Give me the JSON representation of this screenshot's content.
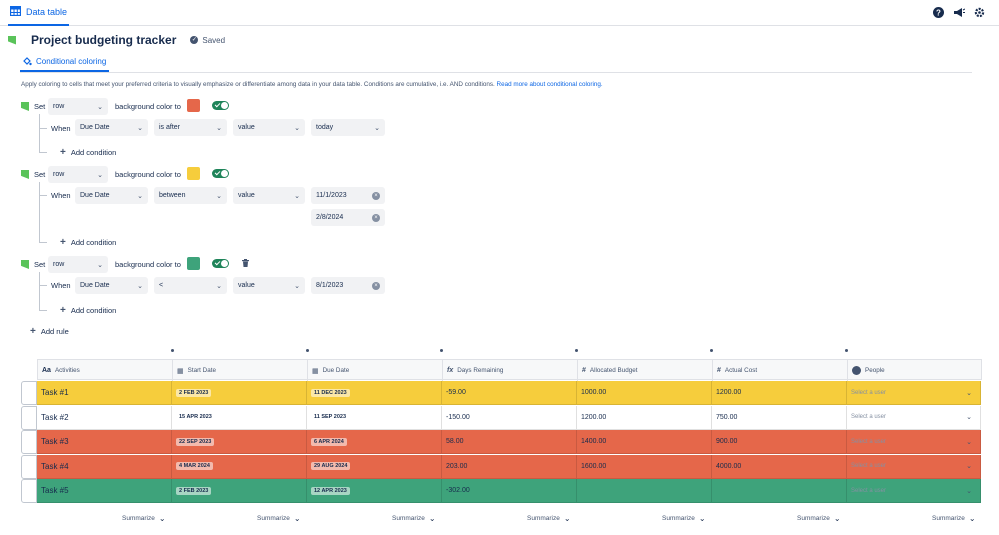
{
  "topbar": {
    "tab_label": "Data table",
    "icons": [
      "help-icon",
      "megaphone-icon",
      "settings-icon"
    ]
  },
  "title": "Project budgeting tracker",
  "saved": "Saved",
  "cc_tab": "Conditional coloring",
  "description": "Apply coloring to cells that meet your preferred criteria to visually emphasize or differentiate among data in your data table. Conditions are cumulative, i.e. AND conditions.",
  "description_link": "Read more about conditional coloring.",
  "labels": {
    "set": "Set",
    "when": "When",
    "bg": "background color to",
    "add_condition": "Add condition",
    "add_rule": "Add rule"
  },
  "rules": [
    {
      "target": "row",
      "color": "#e5674a",
      "enabled": true,
      "conditions": [
        {
          "field": "Due Date",
          "op": "is after",
          "type": "value",
          "value": "today"
        }
      ]
    },
    {
      "target": "row",
      "color": "#f6cd3c",
      "enabled": true,
      "conditions": [
        {
          "field": "Due Date",
          "op": "between",
          "type": "value",
          "value": "11/1/2023",
          "value2": "2/8/2024"
        }
      ]
    },
    {
      "target": "row",
      "color": "#3ea37b",
      "enabled": true,
      "conditions": [
        {
          "field": "Due Date",
          "op": "<",
          "type": "value",
          "value": "8/1/2023"
        }
      ]
    }
  ],
  "columns": [
    "Activities",
    "Start Date",
    "Due Date",
    "Days Remaining",
    "Allocated Budget",
    "Actual Cost",
    "People"
  ],
  "rows": [
    {
      "color": "#f6cd3c",
      "activity": "Task #1",
      "start": "2 FEB 2023",
      "due": "11 DEC 2023",
      "days": "-59.00",
      "budget": "1000.00",
      "cost": "1200.00",
      "people": "Select a user"
    },
    {
      "color": "#ffffff",
      "activity": "Task #2",
      "start": "15 APR 2023",
      "due": "11 SEP 2023",
      "days": "-150.00",
      "budget": "1200.00",
      "cost": "750.00",
      "people": "Select a user"
    },
    {
      "color": "#e5674a",
      "activity": "Task #3",
      "start": "22 SEP 2023",
      "due": "6 APR 2024",
      "days": "58.00",
      "budget": "1400.00",
      "cost": "900.00",
      "people": "Select a user"
    },
    {
      "color": "#e5674a",
      "activity": "Task #4",
      "start": "4 MAR 2024",
      "due": "29 AUG 2024",
      "days": "203.00",
      "budget": "1600.00",
      "cost": "4000.00",
      "people": "Select a user"
    },
    {
      "color": "#3ea37b",
      "activity": "Task #5",
      "start": "2 FEB 2023",
      "due": "12 APR 2023",
      "days": "-302.00",
      "budget": "",
      "cost": "",
      "people": "Select a user"
    }
  ],
  "summarize": "Summarize"
}
